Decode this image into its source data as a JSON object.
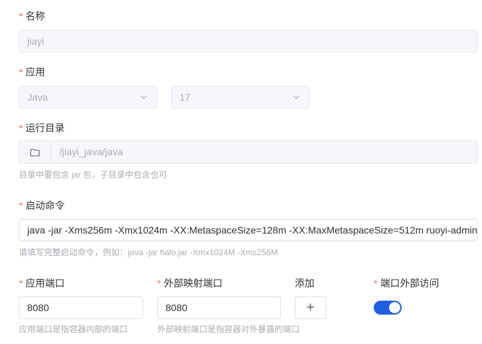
{
  "form": {
    "name": {
      "required": "*",
      "label": "名称",
      "value": "jiayi"
    },
    "app": {
      "required": "*",
      "label": "应用",
      "runtime": "Java",
      "version": "17"
    },
    "run_dir": {
      "required": "*",
      "label": "运行目录",
      "value": "/jiayi_java/java",
      "hint": "目录中要包含 jar 包，子目录中包含也可"
    },
    "start_cmd": {
      "required": "*",
      "label": "启动命令",
      "value": "java -jar -Xms256m -Xmx1024m -XX:MetaspaceSize=128m -XX:MaxMetaspaceSize=512m ruoyi-admin.jar",
      "hint": "请填写完整启动命令，例如：java -jar halo.jar -Xmx1024M -Xms256M"
    },
    "app_port": {
      "required": "*",
      "label": "应用端口",
      "value": "8080",
      "hint": "应用端口是指容器内部的端口"
    },
    "ext_port": {
      "required": "*",
      "label": "外部映射端口",
      "value": "8080",
      "hint": "外部映射端口是指容器对外暴露的端口"
    },
    "add": {
      "label": "添加",
      "button": "+"
    },
    "ext_access": {
      "required": "*",
      "label": "端口外部访问",
      "enabled": true
    }
  },
  "colors": {
    "required": "#f56c6c",
    "switch_on": "#1f5fe0",
    "hint": "#a8abb2"
  },
  "icons": {
    "dir_button": "folder-icon",
    "select": "chevron-down-icon"
  }
}
